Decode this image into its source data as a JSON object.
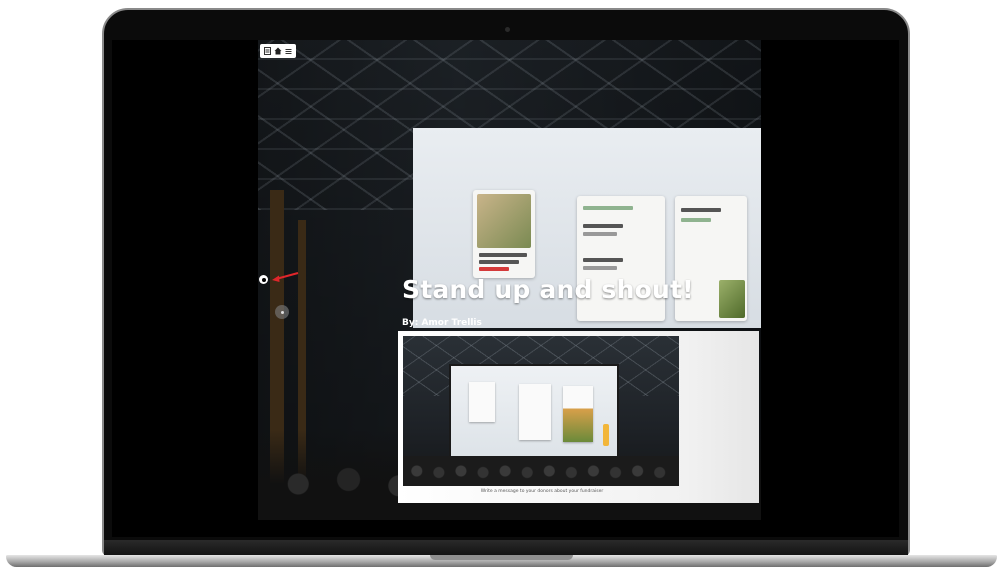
{
  "slide": {
    "title": "Stand up and shout!",
    "byline": "By: Amor Trellis",
    "caption": "Write a message to your donors about your fundraiser"
  },
  "toolbar": {
    "icons": [
      "layers-icon",
      "home-icon",
      "menu-icon"
    ]
  },
  "presentation_screen": {
    "card_texts": [
      "Loft with Open Floor Plan and Kitchen",
      "Los Angeles"
    ]
  },
  "colors": {
    "accent_arrow": "#e0262a",
    "title_text": "#ffffff",
    "screen_bg": "#000000"
  }
}
